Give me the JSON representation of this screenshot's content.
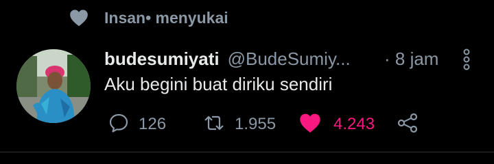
{
  "social_context": {
    "text": "Insan• menyukai"
  },
  "tweet": {
    "display_name": "budesumiyati",
    "handle": "@BudeSumiy...",
    "time": "· 8 jam",
    "text": "Aku begini buat diriku sendiri"
  },
  "actions": {
    "reply_count": "126",
    "retweet_count": "1.955",
    "like_count": "4.243"
  },
  "colors": {
    "background": "#000000",
    "secondary_text": "#8b98a5",
    "like_active": "#f91880"
  },
  "icons": [
    "heart-icon",
    "reply-icon",
    "retweet-icon",
    "like-icon",
    "share-icon",
    "more-icon"
  ]
}
